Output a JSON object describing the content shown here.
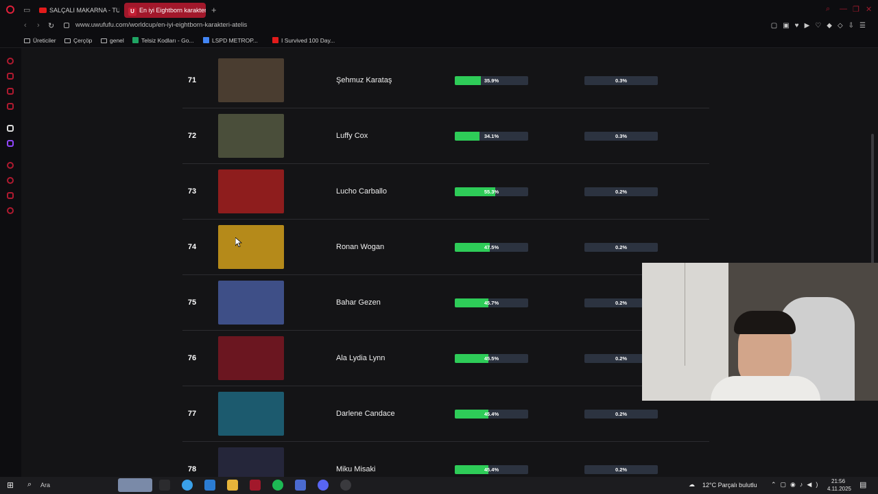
{
  "browser": {
    "tabs": [
      {
        "label": "SALÇALI MAKARNA - TUR",
        "active": false
      },
      {
        "label": "En iyi Eightborn karakteri",
        "active": true
      }
    ],
    "url": "www.uwufufu.com/worldcup/en-iyi-eightborn-karakteri-atelis",
    "bookmarks": [
      {
        "label": "Üreticiler",
        "icon": "folder-icon"
      },
      {
        "label": "Çerçöp",
        "icon": "folder-icon"
      },
      {
        "label": "genel",
        "icon": "folder-icon"
      },
      {
        "label": "Telsiz Kodları - Go...",
        "icon": "sheets-icon"
      },
      {
        "label": "LSPD METROP...",
        "icon": "docs-icon"
      },
      {
        "label": "I Survived 100 Day...",
        "icon": "youtube-icon"
      }
    ]
  },
  "ranking": {
    "rows": [
      {
        "rank": "71",
        "name": "Şehmuz Karataş",
        "win_rate_label": "35.9%",
        "win_rate": 35.9,
        "champion_label": "0.3%",
        "champion": 0.3,
        "thumb_color": "#4a3d30"
      },
      {
        "rank": "72",
        "name": "Luffy Cox",
        "win_rate_label": "34.1%",
        "win_rate": 34.1,
        "champion_label": "0.3%",
        "champion": 0.3,
        "thumb_color": "#4a4e3a"
      },
      {
        "rank": "73",
        "name": "Lucho Carballo",
        "win_rate_label": "55.3%",
        "win_rate": 55.3,
        "champion_label": "0.2%",
        "champion": 0.2,
        "thumb_color": "#8e1d1d"
      },
      {
        "rank": "74",
        "name": "Ronan Wogan",
        "win_rate_label": "47.5%",
        "win_rate": 47.5,
        "champion_label": "0.2%",
        "champion": 0.2,
        "thumb_color": "#b58a1a"
      },
      {
        "rank": "75",
        "name": "Bahar Gezen",
        "win_rate_label": "45.7%",
        "win_rate": 45.7,
        "champion_label": "0.2%",
        "champion": 0.2,
        "thumb_color": "#3e4f87"
      },
      {
        "rank": "76",
        "name": "Ala Lydia Lynn",
        "win_rate_label": "45.5%",
        "win_rate": 45.5,
        "champion_label": "0.2%",
        "champion": 0.2,
        "thumb_color": "#6b1620"
      },
      {
        "rank": "77",
        "name": "Darlene Candace",
        "win_rate_label": "45.4%",
        "win_rate": 45.4,
        "champion_label": "0.2%",
        "champion": 0.2,
        "thumb_color": "#1c5a6e"
      },
      {
        "rank": "78",
        "name": "Miku Misaki",
        "win_rate_label": "45.4%",
        "win_rate": 45.4,
        "champion_label": "0.2%",
        "champion": 0.2,
        "thumb_color": "#25263a"
      }
    ]
  },
  "taskbar": {
    "search_placeholder": "Ara",
    "weather": "12°C  Parçalı bulutlu",
    "time": "21:56",
    "date": "4.11.2025"
  },
  "colors": {
    "accent": "#a2182b",
    "bar_fill": "#2ecc58",
    "bar_track": "#2c3340"
  }
}
